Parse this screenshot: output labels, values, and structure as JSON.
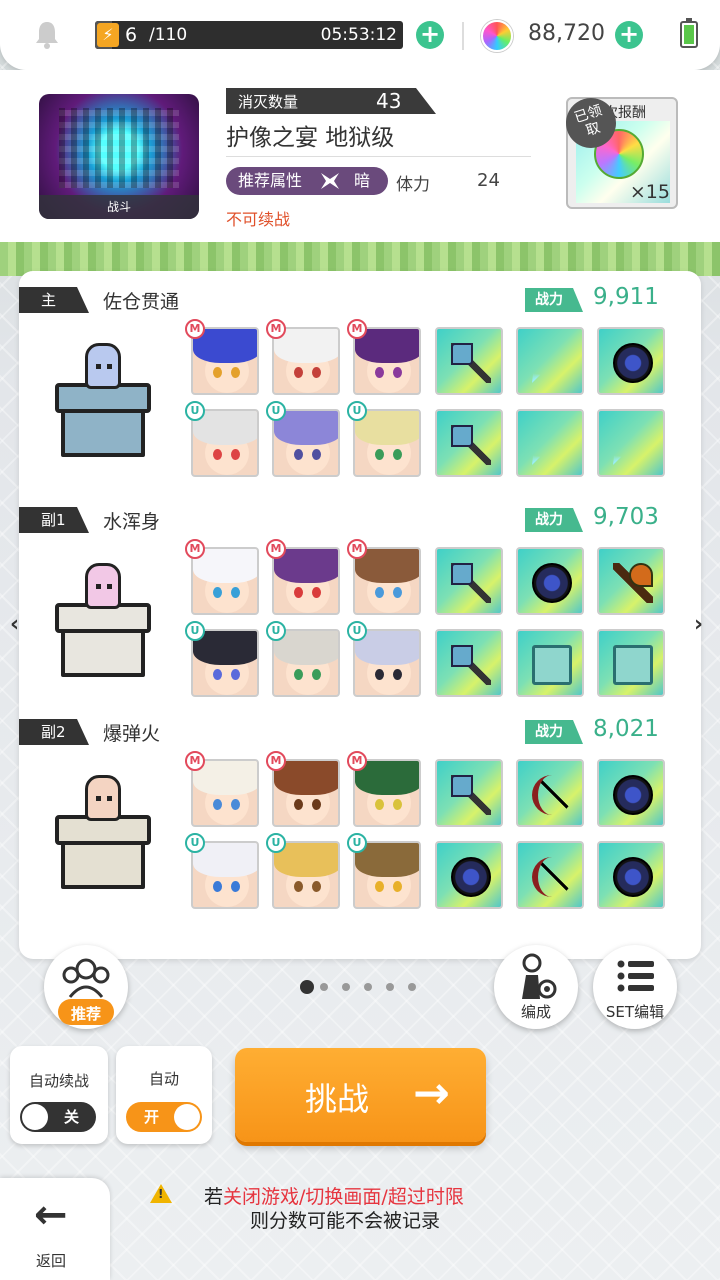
{
  "topbar": {
    "stamina_current": "6",
    "stamina_max": "/110",
    "stamina_fraction": 0.055,
    "timer": "05:53:12",
    "gem_count": "88,720",
    "plus_symbol": "+",
    "bolt_symbol": "⚡"
  },
  "stage": {
    "thumb_label": "战斗",
    "kill_label": "消灭数量",
    "kill_count": "43",
    "title": "护像之宴 地狱级",
    "recommend_label": "推荐属性",
    "recommend_attr": "暗",
    "stamina_label": "体力",
    "stamina_cost": "24",
    "continue_warning": "不可续战",
    "reward_header": "次报酬",
    "reward_qty": "×15",
    "claimed_badge": "已领取"
  },
  "teams": [
    {
      "slot": "主",
      "name": "佐仓贯通",
      "power_label": "战力",
      "power": "9,911",
      "pedestal_color": "#8fb3c7",
      "char_color": "#b9c9ef",
      "units": [
        {
          "badge": "M",
          "hair": "#3b4ad0",
          "eye": "#e4a12c"
        },
        {
          "badge": "M",
          "hair": "#f2f2f2",
          "eye": "#c4403a"
        },
        {
          "badge": "M",
          "hair": "#5b2a7d",
          "eye": "#8a3a9c"
        },
        {
          "badge": "U",
          "hair": "#e3e3e3",
          "eye": "#d44"
        },
        {
          "badge": "U",
          "hair": "#8c86d8",
          "eye": "#5050a0"
        },
        {
          "badge": "U",
          "hair": "#e8dfa0",
          "eye": "#3a9c5a"
        }
      ],
      "equips": [
        "weapon",
        "fan",
        "accessory",
        "weapon",
        "fan",
        "fan"
      ]
    },
    {
      "slot": "副1",
      "name": "水浑身",
      "power_label": "战力",
      "power": "9,703",
      "pedestal_color": "#e8e6df",
      "char_color": "#f2c8e6",
      "units": [
        {
          "badge": "M",
          "hair": "#f6f6fa",
          "eye": "#38a0d8"
        },
        {
          "badge": "M",
          "hair": "#6b3a8c",
          "eye": "#d93b3b"
        },
        {
          "badge": "M",
          "hair": "#8a5a3a",
          "eye": "#4a9adb"
        },
        {
          "badge": "U",
          "hair": "#2a2a36",
          "eye": "#5a6adb"
        },
        {
          "badge": "U",
          "hair": "#d9d6cf",
          "eye": "#3a9c5a"
        },
        {
          "badge": "U",
          "hair": "#c9cde6",
          "eye": "#2a2a36"
        }
      ],
      "equips": [
        "weapon",
        "accessory",
        "sword",
        "weapon",
        "book",
        "book"
      ]
    },
    {
      "slot": "副2",
      "name": "爆弹火",
      "power_label": "战力",
      "power": "8,021",
      "pedestal_color": "#e4e0d2",
      "char_color": "#f4d4c2",
      "units": [
        {
          "badge": "M",
          "hair": "#f4f0e6",
          "eye": "#4a8ad8"
        },
        {
          "badge": "M",
          "hair": "#8a4a2a",
          "eye": "#6b3a1a"
        },
        {
          "badge": "M",
          "hair": "#2b6b3a",
          "eye": "#d9c23b"
        },
        {
          "badge": "U",
          "hair": "#f0f0f6",
          "eye": "#3a7ad8"
        },
        {
          "badge": "U",
          "hair": "#e8c05a",
          "eye": "#8a5a2a"
        },
        {
          "badge": "U",
          "hair": "#8a6a3a",
          "eye": "#e8b02a"
        }
      ],
      "equips": [
        "weapon",
        "bow",
        "accessory",
        "accessory",
        "bow",
        "accessory"
      ]
    }
  ],
  "nav": {
    "prev_arrow": "‹",
    "next_arrow": "›",
    "page_count": 6,
    "page_active": 0
  },
  "buttons": {
    "recommend": "推荐",
    "edit": "编成",
    "set_edit": "SET编辑",
    "auto_continue_label": "自动续战",
    "auto_continue_state": "关",
    "auto_label": "自动",
    "auto_state": "开",
    "challenge": "挑战",
    "challenge_arrow": "→",
    "back": "返回",
    "back_arrow": "←"
  },
  "warning": {
    "prefix": "若",
    "highlight": "关闭游戏/切换画面/超过时限",
    "line2": "则分数可能不会被记录"
  },
  "colors": {
    "accent_green": "#3ab08a",
    "challenge_orange": "#f79418",
    "toggle_on": "#f79418",
    "toggle_off": "#333333",
    "warning_red": "#e6353f"
  }
}
